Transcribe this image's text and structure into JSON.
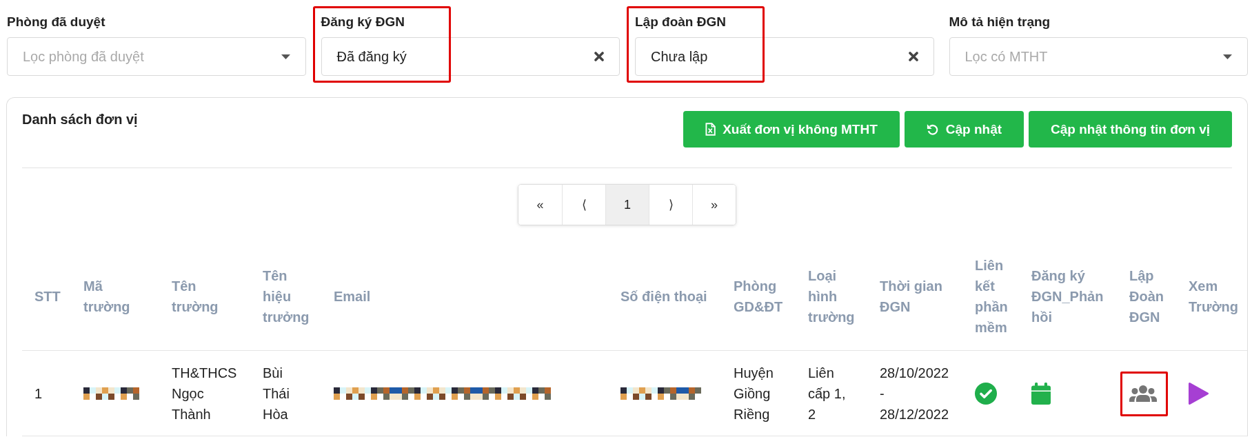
{
  "filters": [
    {
      "label": "Phòng đã duyệt",
      "placeholder": "Lọc phòng đã duyệt",
      "highlighted": false
    },
    {
      "label": "Đăng ký ĐGN",
      "value": "Đã đăng ký",
      "highlighted": true
    },
    {
      "label": "Lập đoàn ĐGN",
      "value": "Chưa lập",
      "highlighted": true
    },
    {
      "label": "Mô tả hiện trạng",
      "placeholder": "Lọc có MTHT",
      "highlighted": false
    }
  ],
  "panel": {
    "title": "Danh sách đơn vị",
    "buttons": [
      {
        "kind": "export",
        "label": "Xuất đơn vị không MTHT"
      },
      {
        "kind": "refresh",
        "label": "Cập nhật"
      },
      {
        "kind": "plain",
        "label": "Cập nhật thông tin đơn vị"
      }
    ],
    "pagination": [
      {
        "label": "«",
        "selected": false
      },
      {
        "label": "⟨",
        "selected": false
      },
      {
        "label": "1",
        "selected": true
      },
      {
        "label": "⟩",
        "selected": false
      },
      {
        "label": "»",
        "selected": false
      }
    ],
    "table": {
      "columns": [
        "STT",
        "Mã trường",
        "Tên trường",
        "Tên hiệu trưởng",
        "Email",
        "Số điện thoại",
        "Phòng GD&ĐT",
        "Loại hình trường",
        "Thời gian ĐGN",
        "Liên kết phần mềm",
        "Đăng ký ĐGN_Phản hồi",
        "Lập Đoàn ĐGN",
        "Xem Trường"
      ],
      "rows": [
        {
          "cells": [
            {
              "kind": "text",
              "text": "1"
            },
            {
              "kind": "pixelated"
            },
            {
              "kind": "text",
              "text": "TH&THCS Ngọc Thành"
            },
            {
              "kind": "text",
              "text": "Bùi Thái Hòa"
            },
            {
              "kind": "pixelated"
            },
            {
              "kind": "pixelated"
            },
            {
              "kind": "text",
              "text": "Huyện Giồng Riềng"
            },
            {
              "kind": "text",
              "text": "Liên cấp 1, 2"
            },
            {
              "kind": "text",
              "text": "28/10/2022 - 28/12/2022"
            }
          ],
          "actions": [
            {
              "kind": "check",
              "highlighted": false
            },
            {
              "kind": "calendar",
              "highlighted": false
            },
            {
              "kind": "group",
              "highlighted": true
            },
            {
              "kind": "play",
              "highlighted": false
            }
          ]
        }
      ]
    }
  }
}
